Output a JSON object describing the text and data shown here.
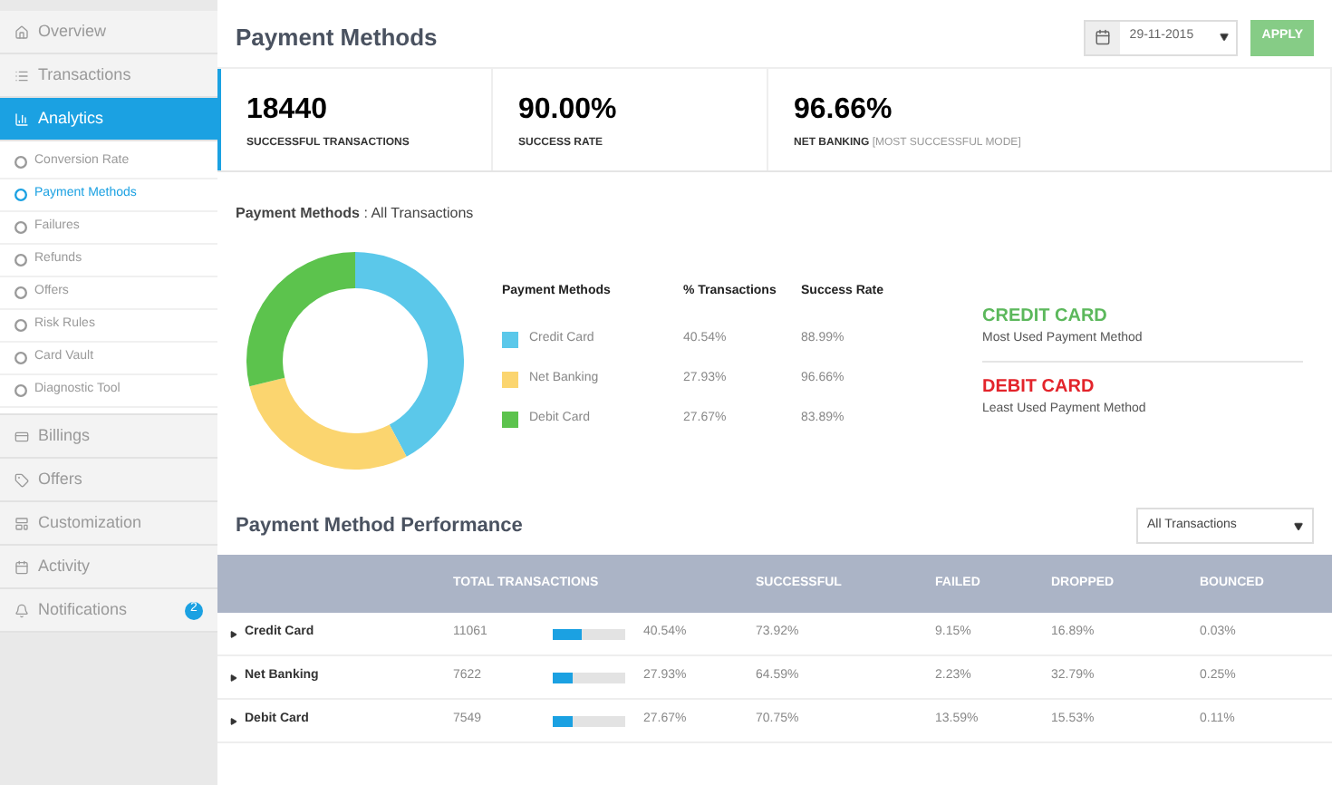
{
  "sidebar": {
    "items": [
      {
        "label": "Overview",
        "selected": false
      },
      {
        "label": "Transactions",
        "selected": false
      },
      {
        "label": "Analytics",
        "selected": true,
        "children": [
          {
            "label": "Conversion Rate",
            "selected": false
          },
          {
            "label": "Payment Methods",
            "selected": true
          },
          {
            "label": "Failures",
            "selected": false
          },
          {
            "label": "Refunds",
            "selected": false
          },
          {
            "label": "Offers",
            "selected": false
          },
          {
            "label": "Risk Rules",
            "selected": false
          },
          {
            "label": "Card Vault",
            "selected": false
          },
          {
            "label": "Diagnostic Tool",
            "selected": false
          }
        ]
      },
      {
        "label": "Billings",
        "selected": false
      },
      {
        "label": "Offers",
        "selected": false
      },
      {
        "label": "Customization",
        "selected": false
      },
      {
        "label": "Activity",
        "selected": false
      },
      {
        "label": "Notifications",
        "selected": false,
        "badge": "2"
      }
    ]
  },
  "header": {
    "title": "Payment Methods",
    "date": "29-11-2015",
    "apply": "APPLY"
  },
  "stats": [
    {
      "value": "18440",
      "label": "SUCCESSFUL TRANSACTIONS"
    },
    {
      "value": "90.00%",
      "label": "SUCCESS RATE"
    },
    {
      "value": "96.66%",
      "label": "NET BANKING",
      "note": "[MOST SUCCESSFUL MODE]"
    }
  ],
  "breakdown": {
    "title": "Payment Methods",
    "subtitle": ": All Transactions",
    "legend_columns": [
      "Payment Methods",
      "% Transactions",
      "Success Rate"
    ],
    "legend": [
      {
        "name": "Credit Card",
        "color": "#5bc8ea",
        "share": "40.54%",
        "success": "88.99%"
      },
      {
        "name": "Net Banking",
        "color": "#fbd56f",
        "share": "27.93%",
        "success": "96.66%"
      },
      {
        "name": "Debit Card",
        "color": "#5cc34d",
        "share": "27.67%",
        "success": "83.89%"
      }
    ],
    "highlights": [
      {
        "kind": "most",
        "title": "CREDIT CARD",
        "caption": "Most Used Payment Method"
      },
      {
        "kind": "least",
        "title": "DEBIT CARD",
        "caption": "Least Used Payment Method"
      }
    ]
  },
  "performance": {
    "title": "Payment Method Performance",
    "filter": "All Transactions",
    "columns": [
      "TOTAL TRANSACTIONS",
      "SUCCESSFUL",
      "FAILED",
      "DROPPED",
      "BOUNCED"
    ],
    "rows": [
      {
        "name": "Credit Card",
        "total": "11061",
        "level": 0.4054,
        "share": "40.54%",
        "successful": "73.92%",
        "failed": "9.15%",
        "dropped": "16.89%",
        "bounced": "0.03%"
      },
      {
        "name": "Net Banking",
        "total": "7622",
        "level": 0.2793,
        "share": "27.93%",
        "successful": "64.59%",
        "failed": "2.23%",
        "dropped": "32.79%",
        "bounced": "0.25%"
      },
      {
        "name": "Debit Card",
        "total": "7549",
        "level": 0.2767,
        "share": "27.67%",
        "successful": "70.75%",
        "failed": "13.59%",
        "dropped": "15.53%",
        "bounced": "0.11%"
      }
    ]
  }
}
